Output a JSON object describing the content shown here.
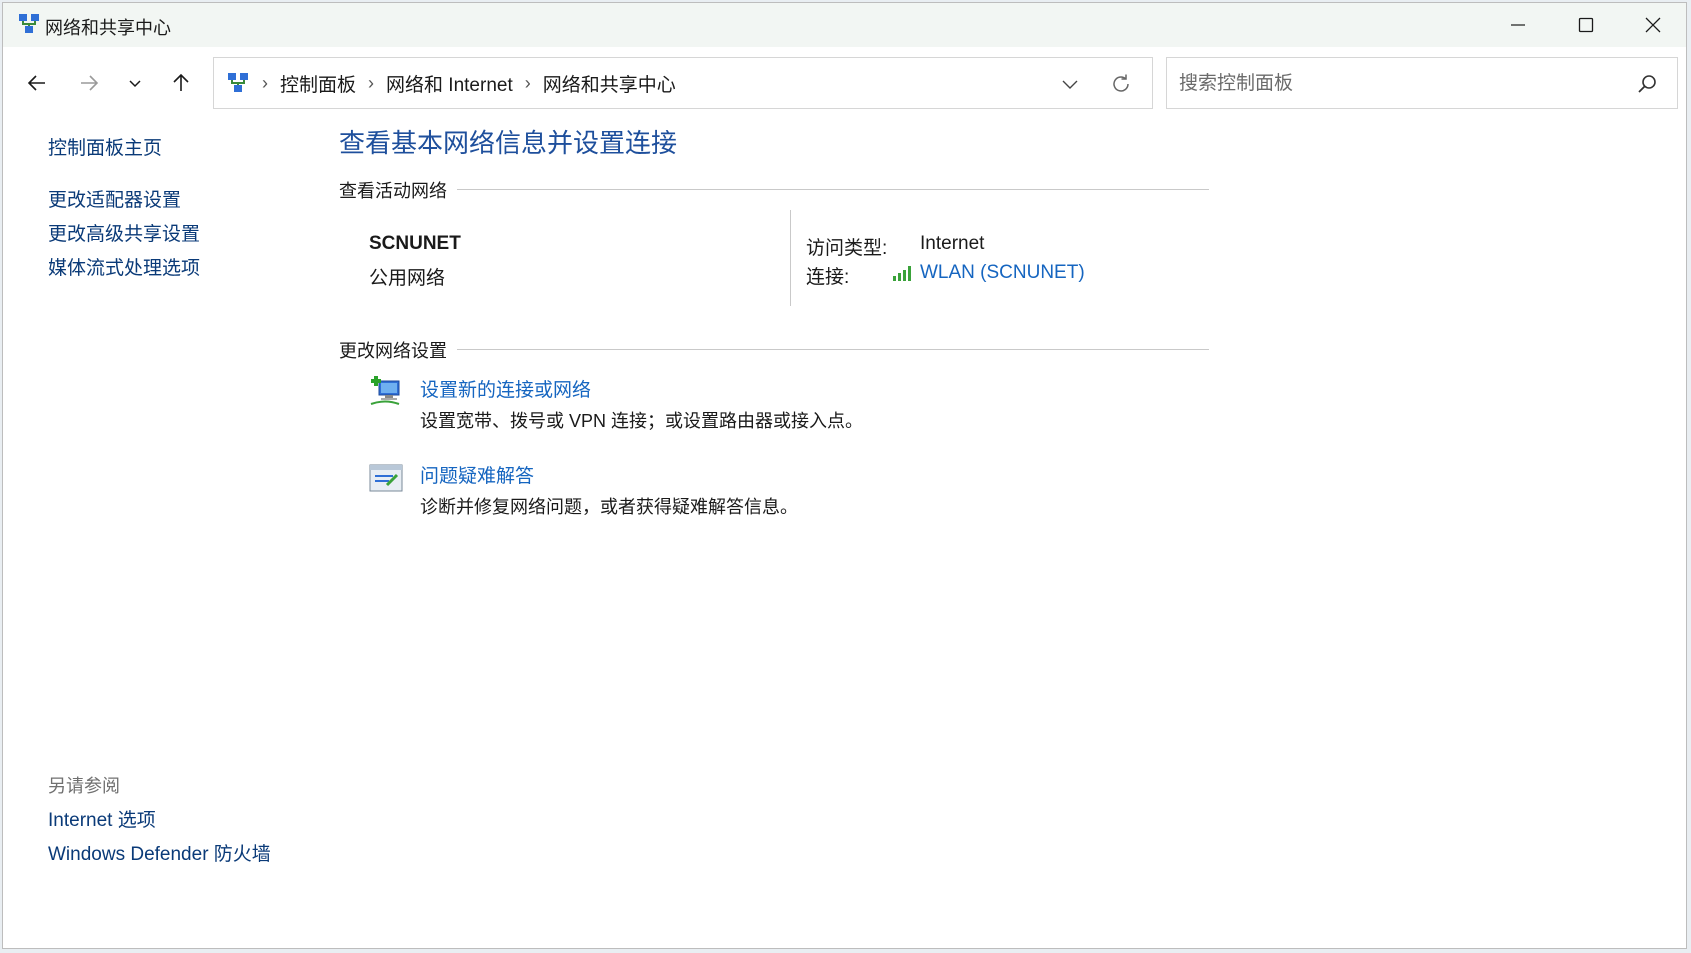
{
  "window": {
    "title": "网络和共享中心"
  },
  "address": {
    "crumbs": [
      "控制面板",
      "网络和 Internet",
      "网络和共享中心"
    ],
    "search_placeholder": "搜索控制面板"
  },
  "sidebar": {
    "home": "控制面板主页",
    "links": [
      "更改适配器设置",
      "更改高级共享设置",
      "媒体流式处理选项"
    ],
    "see_also_heading": "另请参阅",
    "see_also": [
      "Internet 选项",
      "Windows Defender 防火墙"
    ]
  },
  "main": {
    "title": "查看基本网络信息并设置连接",
    "active_heading": "查看活动网络",
    "network": {
      "name": "SCNUNET",
      "category": "公用网络",
      "access_label": "访问类型:",
      "access_value": "Internet",
      "connection_label": "连接:",
      "connection_value": "WLAN (SCNUNET)"
    },
    "change_heading": "更改网络设置",
    "tasks": [
      {
        "title": "设置新的连接或网络",
        "desc": "设置宽带、拨号或 VPN 连接；或设置路由器或接入点。",
        "icon": "new-connection-icon"
      },
      {
        "title": "问题疑难解答",
        "desc": "诊断并修复网络问题，或者获得疑难解答信息。",
        "icon": "troubleshoot-icon"
      }
    ]
  },
  "colors": {
    "link": "#1565c0",
    "heading": "#1e4f9c",
    "sidebar_link": "#0a3a78",
    "titlebar": "#f2f6f3"
  }
}
